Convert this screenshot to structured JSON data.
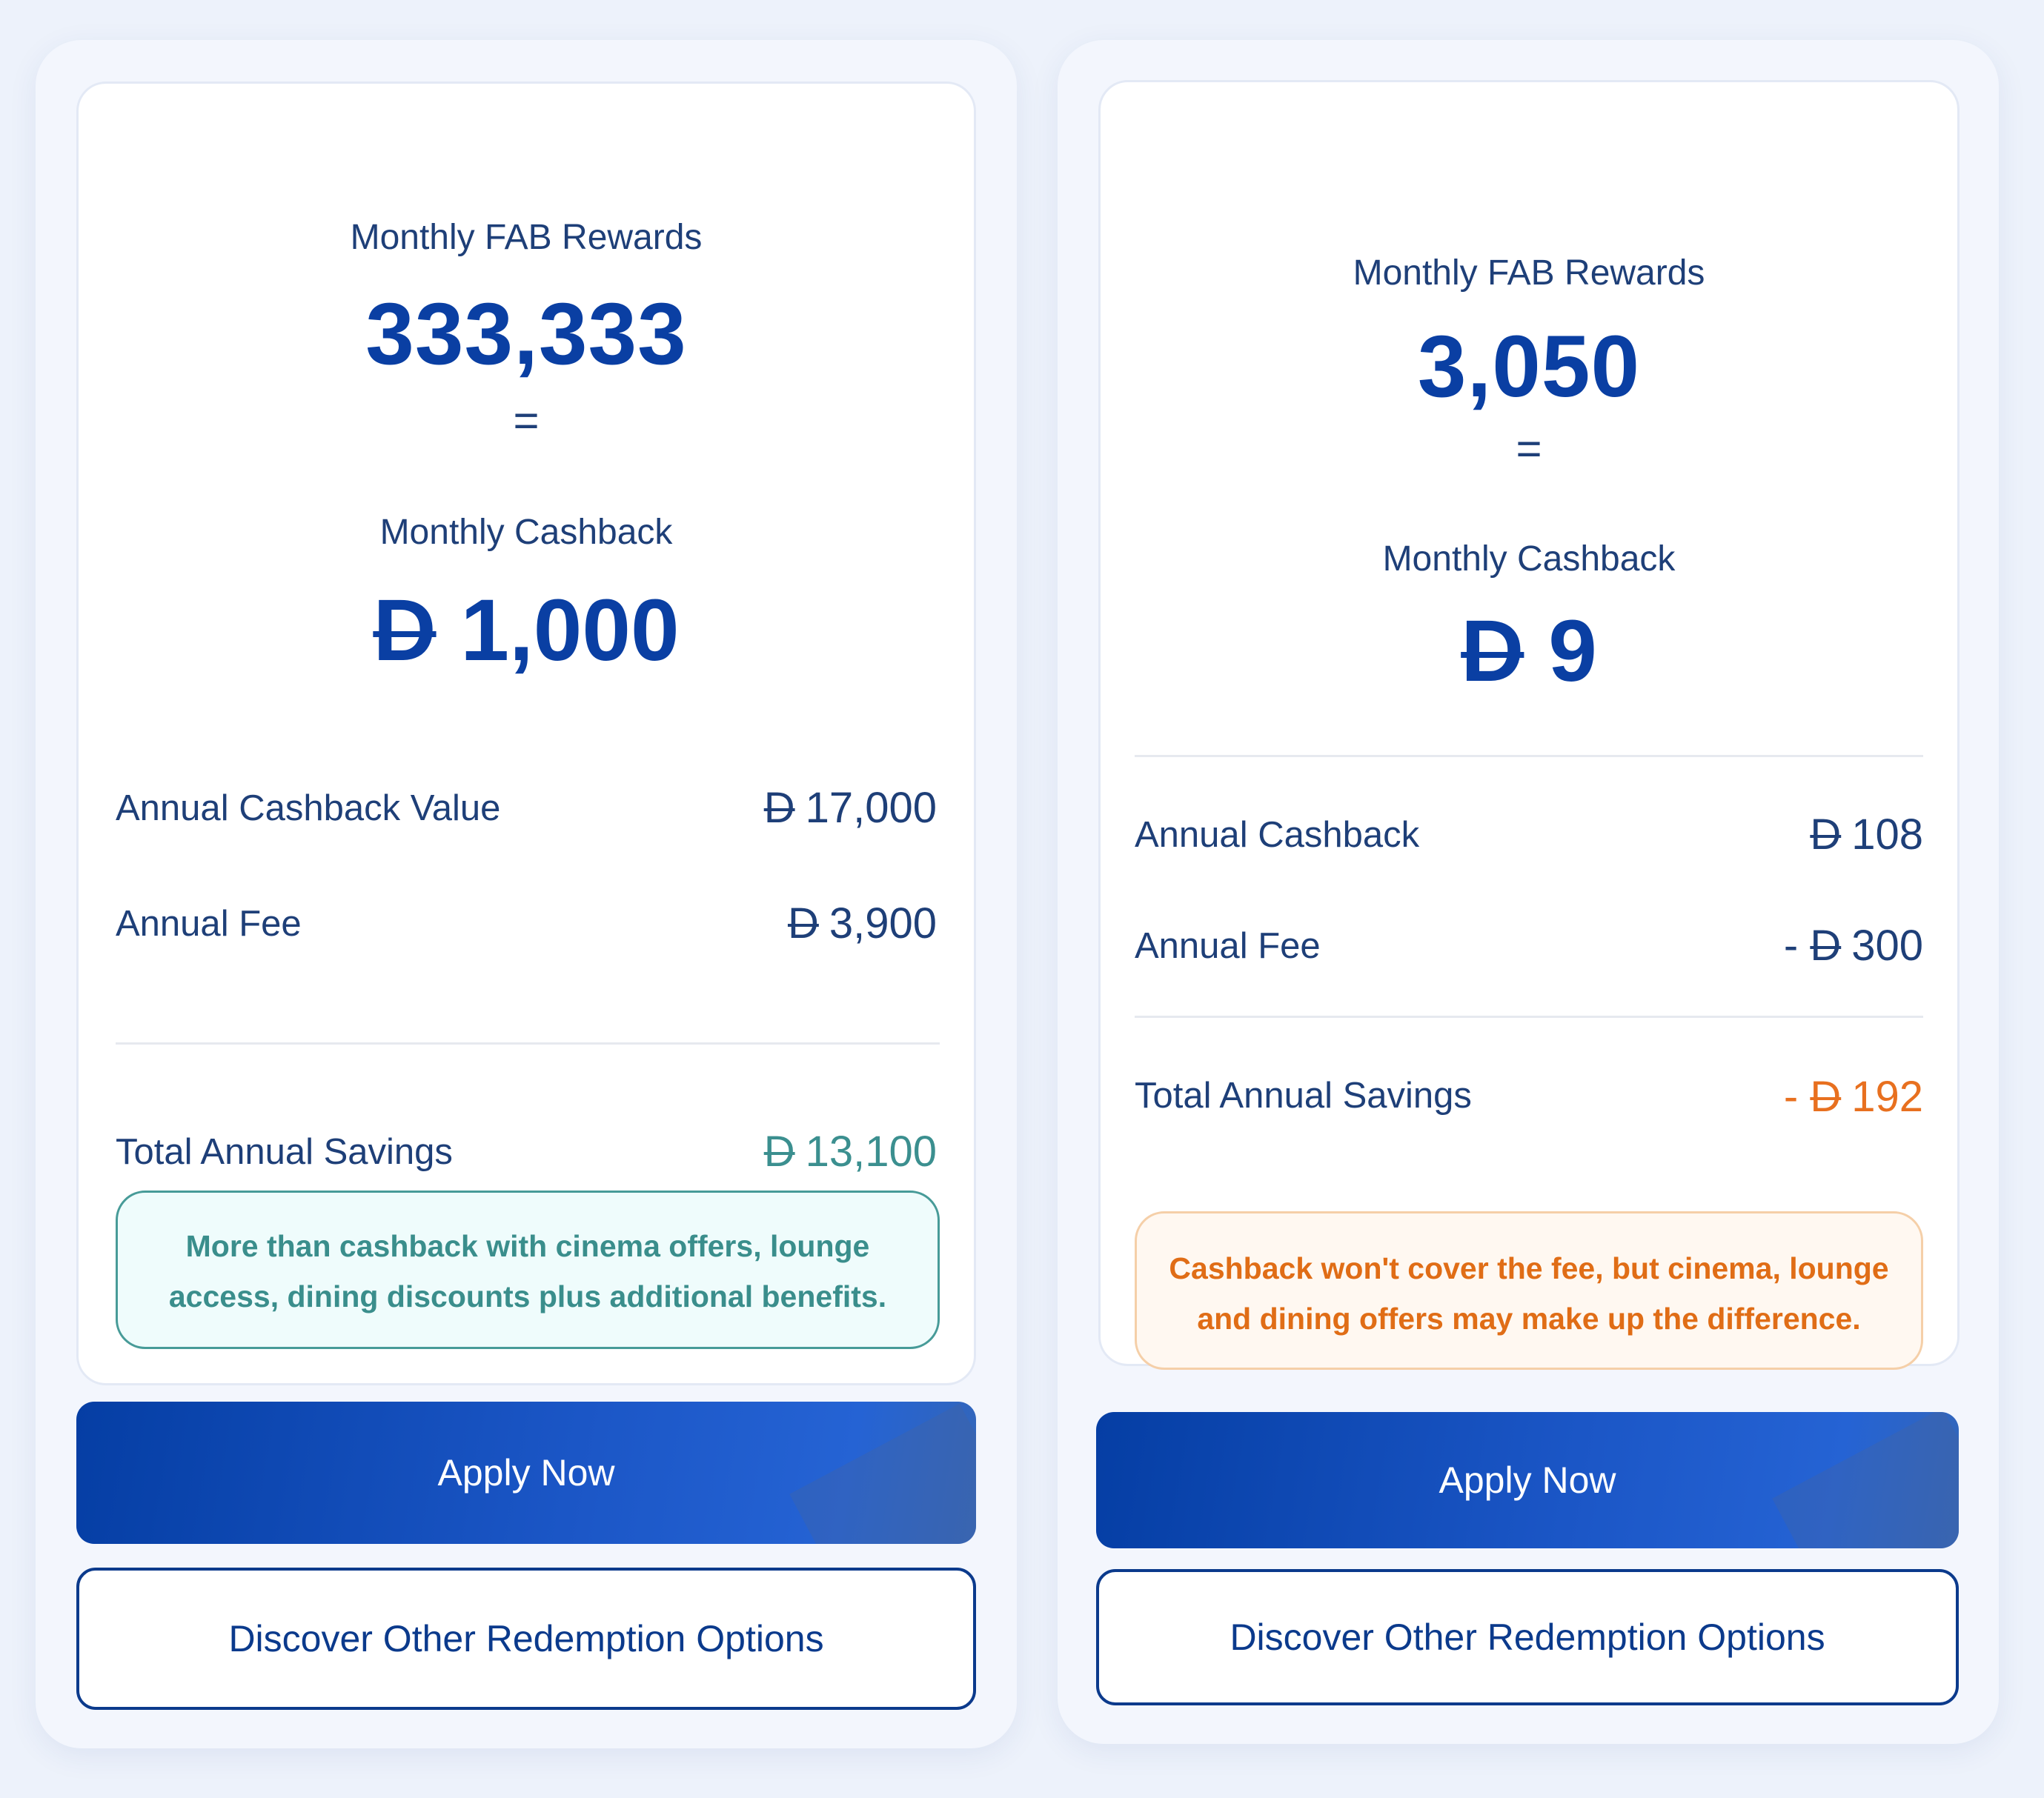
{
  "cards": [
    {
      "rewards_label": "Monthly FAB Rewards",
      "rewards_value": "333,333",
      "equals": "=",
      "cashback_label": "Monthly Cashback",
      "currency_symbol": "D",
      "cashback_value": "1,000",
      "rows": [
        {
          "label": "Annual Cashback Value",
          "prefix": "",
          "value": "17,000"
        },
        {
          "label": "Annual Fee",
          "prefix": "",
          "value": "3,900"
        }
      ],
      "total": {
        "label": "Total Annual Savings",
        "prefix": "",
        "value": "13,100",
        "color": "#3b8f8f"
      },
      "note": "More than cashback with cinema offers, lounge access, dining discounts plus additional benefits.",
      "apply_label": "Apply Now",
      "discover_label": "Discover Other Redemption Options"
    },
    {
      "rewards_label": "Monthly FAB Rewards",
      "rewards_value": "3,050",
      "equals": "=",
      "cashback_label": "Monthly Cashback",
      "currency_symbol": "D",
      "cashback_value": "9",
      "rows": [
        {
          "label": "Annual Cashback",
          "prefix": "",
          "value": "108"
        },
        {
          "label": "Annual Fee",
          "prefix": "- ",
          "value": "300"
        }
      ],
      "total": {
        "label": "Total Annual Savings",
        "prefix": "- ",
        "value": "192",
        "color": "#e8701f"
      },
      "note": "Cashback won't cover the fee, but cinema, lounge and dining offers may make up the difference.",
      "apply_label": "Apply Now",
      "discover_label": "Discover Other Redemption Options"
    }
  ]
}
